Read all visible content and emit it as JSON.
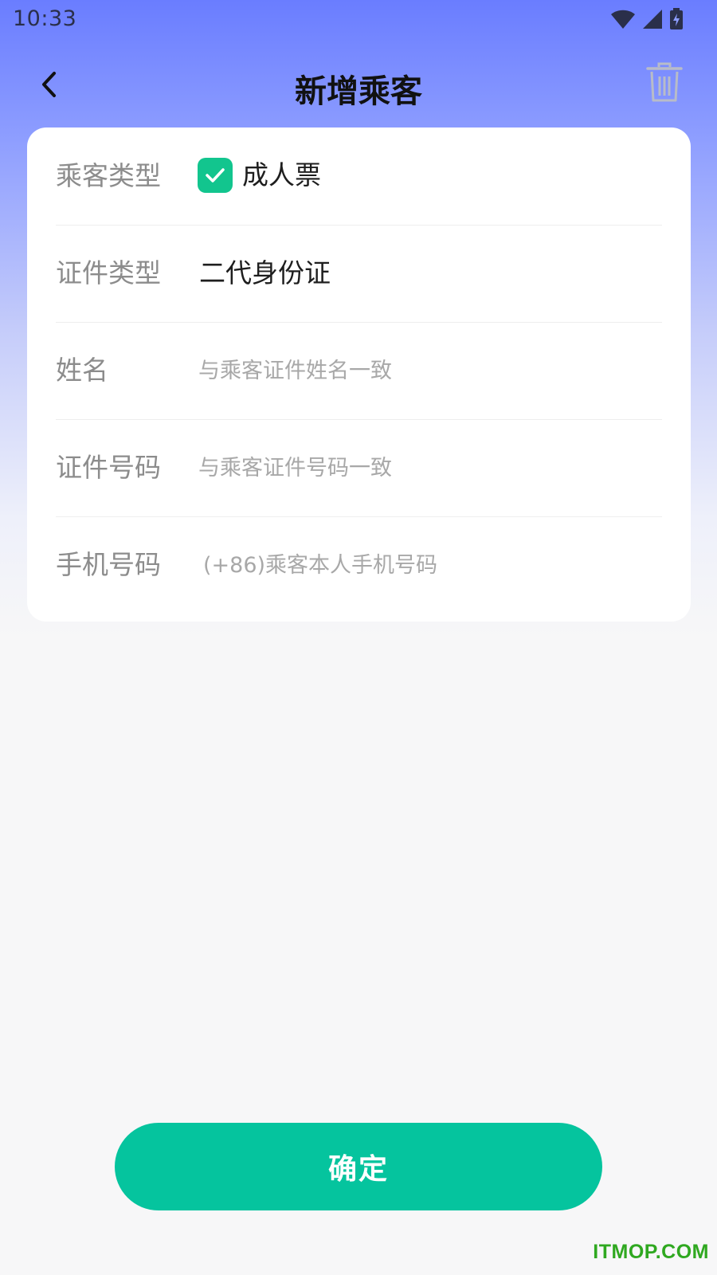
{
  "status_bar": {
    "time": "10:33",
    "icons": [
      "wifi-icon",
      "cellular-signal-icon",
      "battery-charging-icon"
    ]
  },
  "header": {
    "title": "新增乘客",
    "back_icon": "chevron-left-icon",
    "delete_icon": "trash-icon"
  },
  "form": {
    "passenger_type": {
      "label": "乘客类型",
      "option_label": "成人票",
      "checked": true
    },
    "id_type": {
      "label": "证件类型",
      "value": "二代身份证"
    },
    "name": {
      "label": "姓名",
      "value": "",
      "placeholder": "与乘客证件姓名一致"
    },
    "id_number": {
      "label": "证件号码",
      "value": "",
      "placeholder": "与乘客证件号码一致"
    },
    "phone": {
      "label": "手机号码",
      "value": "",
      "placeholder": "(+86)乘客本人手机号码"
    }
  },
  "confirm_label": "确定",
  "watermark": "ITMOP.COM",
  "colors": {
    "accent_green": "#05c49e",
    "checkbox_green": "#12c58e",
    "header_gradient_top": "#6a7dff",
    "page_background": "#f7f7f8",
    "watermark_green": "#2fa820"
  }
}
